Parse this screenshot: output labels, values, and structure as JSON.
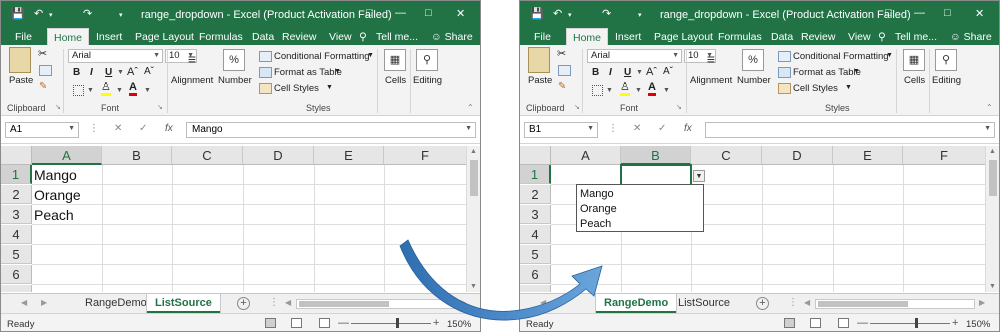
{
  "left": {
    "title": "range_dropdown - Excel (Product Activation Failed)",
    "tabs": [
      "File",
      "Home",
      "Insert",
      "Page Layout",
      "Formulas",
      "Data",
      "Review",
      "View",
      "Tell me..."
    ],
    "share": "Share",
    "font_name": "Arial",
    "font_size": "10",
    "groups": {
      "clipboard": "Clipboard",
      "font": "Font",
      "styles": "Styles"
    },
    "paste": "Paste",
    "alignment": "Alignment",
    "number": "Number",
    "percent": "%",
    "cond_fmt": "Conditional Formatting",
    "fmt_table": "Format as Table",
    "cell_styles": "Cell Styles",
    "cells": "Cells",
    "editing": "Editing",
    "name_box": "A1",
    "formula": "Mango",
    "columns": [
      "A",
      "B",
      "C",
      "D",
      "E",
      "F"
    ],
    "rows": [
      "1",
      "2",
      "3",
      "4",
      "5",
      "6"
    ],
    "cells_a": [
      "Mango",
      "Orange",
      "Peach"
    ],
    "sheet_tabs": [
      "RangeDemo",
      "ListSource"
    ],
    "active_sheet": "ListSource",
    "status": "Ready",
    "zoom": "150%"
  },
  "right": {
    "title": "range_dropdown - Excel (Product Activation Failed)",
    "tabs": [
      "File",
      "Home",
      "Insert",
      "Page Layout",
      "Formulas",
      "Data",
      "Review",
      "View",
      "Tell me..."
    ],
    "share": "Share",
    "font_name": "Arial",
    "font_size": "10",
    "groups": {
      "clipboard": "Clipboard",
      "font": "Font",
      "styles": "Styles"
    },
    "paste": "Paste",
    "alignment": "Alignment",
    "number": "Number",
    "percent": "%",
    "cond_fmt": "Conditional Formatting",
    "fmt_table": "Format as Table",
    "cell_styles": "Cell Styles",
    "cells": "Cells",
    "editing": "Editing",
    "name_box": "B1",
    "formula": "",
    "columns": [
      "A",
      "B",
      "C",
      "D",
      "E",
      "F"
    ],
    "rows": [
      "1",
      "2",
      "3",
      "4",
      "5",
      "6"
    ],
    "dropdown_items": [
      "Mango",
      "Orange",
      "Peach"
    ],
    "sheet_tabs": [
      "RangeDemo",
      "ListSource"
    ],
    "active_sheet": "RangeDemo",
    "status": "Ready",
    "zoom": "150%"
  },
  "colors": {
    "excel_green": "#217346",
    "arrow_blue": "#4a88c8"
  },
  "icons": [
    "save-icon",
    "undo-icon",
    "redo-icon",
    "restore-icon",
    "minimize-icon",
    "maximize-icon",
    "close-icon",
    "lightbulb-icon",
    "share-person-icon",
    "paste-icon",
    "cut-icon",
    "copy-icon",
    "format-painter-icon",
    "bold-icon",
    "italic-icon",
    "underline-icon",
    "borders-icon",
    "fill-color-icon",
    "font-color-icon",
    "alignment-icon",
    "percent-icon",
    "conditional-formatting-icon",
    "format-table-icon",
    "cell-styles-icon",
    "cells-icon",
    "search-icon",
    "cancel-icon",
    "enter-icon",
    "function-icon",
    "dropdown-arrow-icon",
    "add-sheet-icon",
    "arrow-icon"
  ]
}
